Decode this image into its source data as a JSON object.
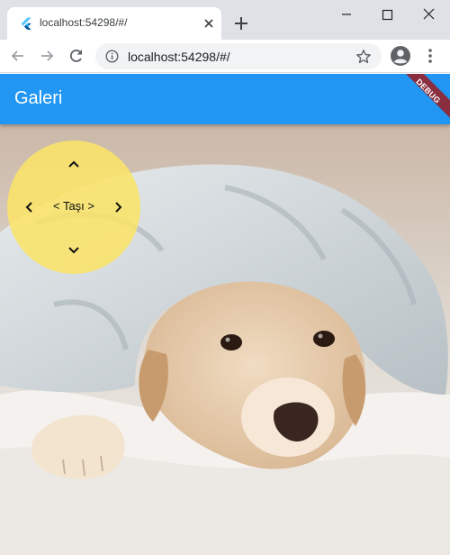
{
  "browser": {
    "tab": {
      "title": "localhost:54298/#/"
    },
    "address_bar": {
      "url": "localhost:54298/#/"
    }
  },
  "app": {
    "title": "Galeri",
    "debug_banner": "DEBUG",
    "move_control": {
      "label": "< Taşı >"
    },
    "colors": {
      "appbar": "#2196f3",
      "control": "#f5e16c"
    }
  },
  "icons": {
    "tab_favicon": "flutter-icon",
    "tab_close": "close-icon",
    "new_tab": "plus-icon",
    "back": "arrow-back-icon",
    "forward": "arrow-forward-icon",
    "reload": "reload-icon",
    "site_info": "info-icon",
    "bookmark": "star-icon",
    "profile": "account-circle-icon",
    "menu": "more-vert-icon",
    "move_up": "chevron-up-icon",
    "move_down": "chevron-down-icon",
    "move_left": "chevron-left-icon",
    "move_right": "chevron-right-icon"
  }
}
